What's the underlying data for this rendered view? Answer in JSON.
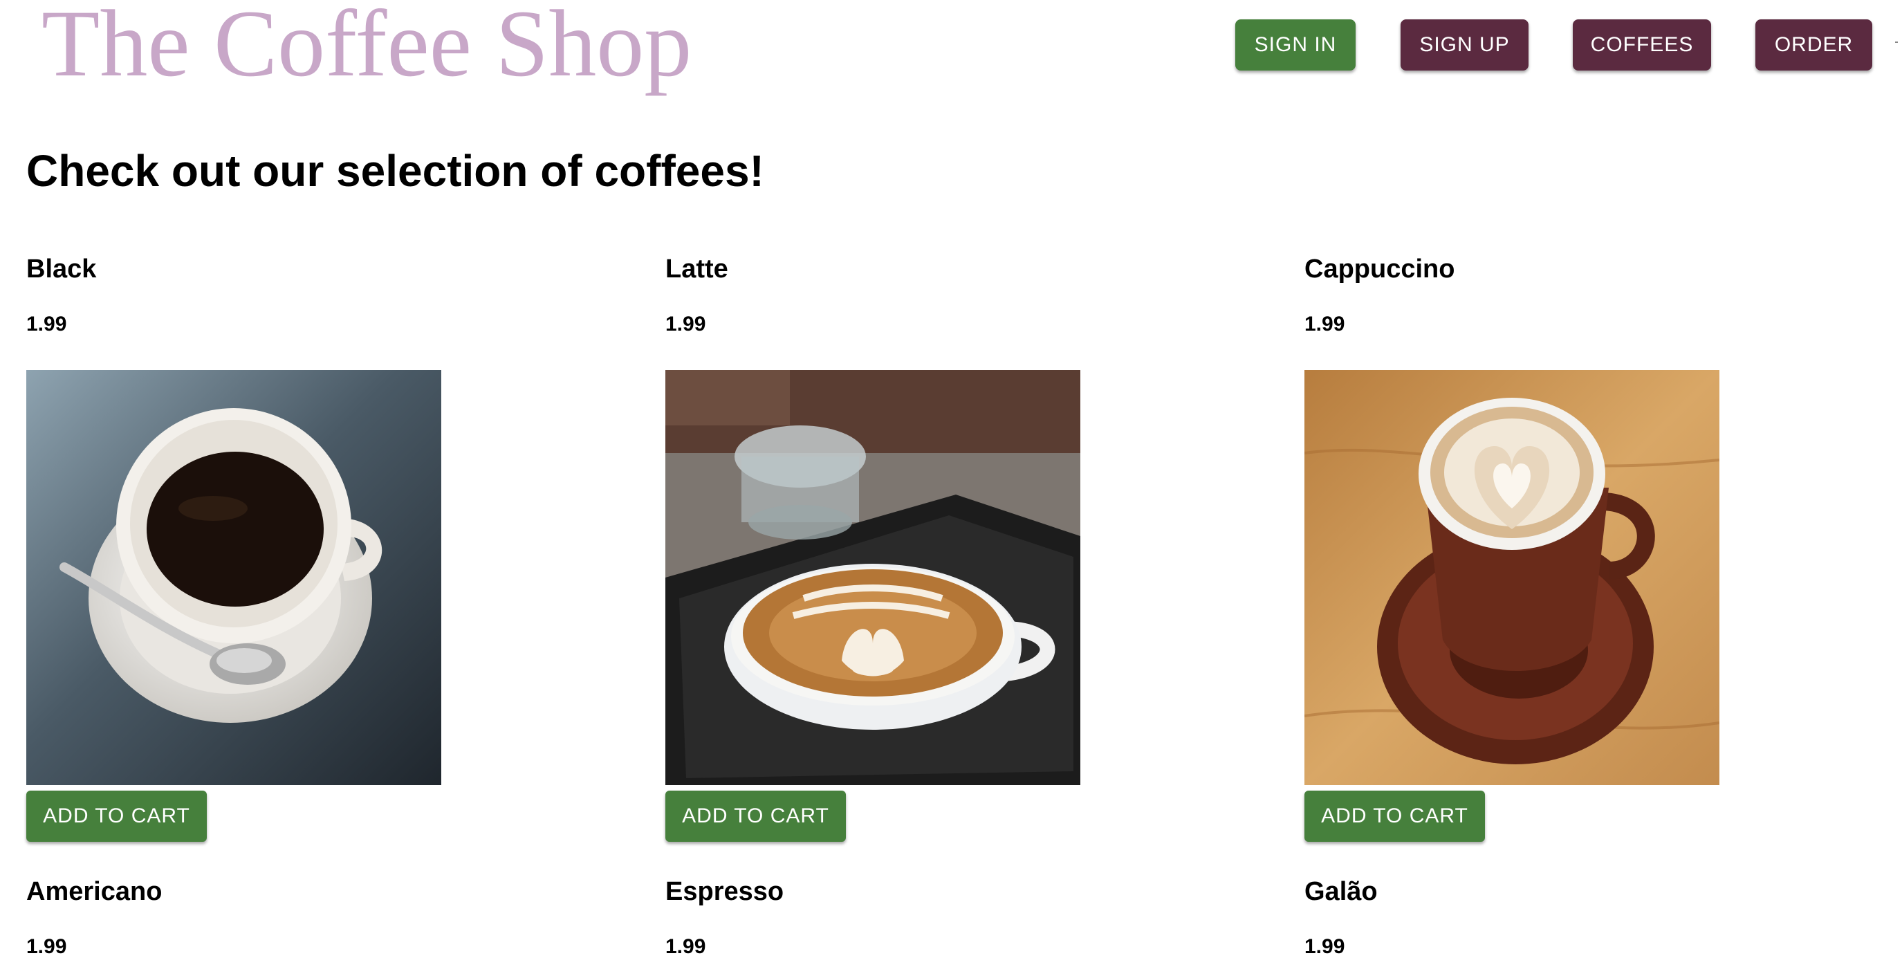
{
  "header": {
    "brand": "The Coffee Shop",
    "nav": {
      "sign_in": "SIGN IN",
      "sign_up": "SIGN UP",
      "coffees": "COFFEES",
      "order": "ORDER"
    }
  },
  "main": {
    "heading": "Check out our selection of coffees!",
    "add_to_cart_label": "ADD TO CART",
    "products": [
      {
        "name": "Black",
        "price": "1.99",
        "image": "black-coffee-cup-photo"
      },
      {
        "name": "Latte",
        "price": "1.99",
        "image": "latte-art-cup-photo"
      },
      {
        "name": "Cappuccino",
        "price": "1.99",
        "image": "cappuccino-heart-cup-photo"
      },
      {
        "name": "Americano",
        "price": "1.99"
      },
      {
        "name": "Espresso",
        "price": "1.99"
      },
      {
        "name": "Galão",
        "price": "1.99"
      }
    ]
  },
  "colors": {
    "brand": "#c8a7c8",
    "sign_in_button": "#46803c",
    "nav_button": "#5b2a40",
    "add_to_cart_button": "#46803c"
  }
}
